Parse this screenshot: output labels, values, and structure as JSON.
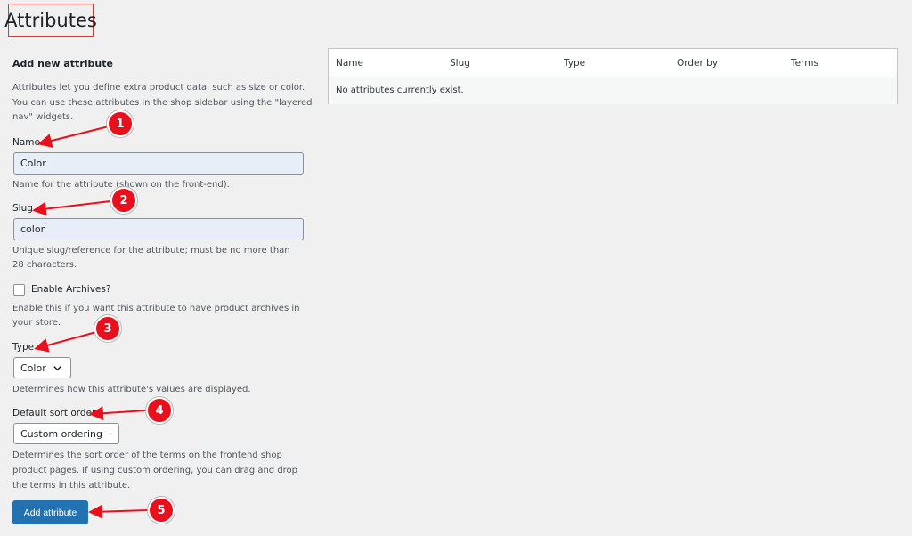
{
  "page": {
    "title": "Attributes"
  },
  "form": {
    "section_title": "Add new attribute",
    "intro_lines": [
      "Attributes let you define extra product data, such as size or color.",
      "You can use these attributes in the shop sidebar using the \"layered",
      "nav\" widgets."
    ],
    "name": {
      "label": "Name",
      "value": "Color",
      "help": "Name for the attribute (shown on the front-end)."
    },
    "slug": {
      "label": "Slug",
      "value": "color",
      "help_lines": [
        "Unique slug/reference for the attribute; must be no more than",
        "28 characters."
      ]
    },
    "archives": {
      "label": "Enable Archives?",
      "checked": false,
      "help_lines": [
        "Enable this if you want this attribute to have product archives in",
        "your store."
      ]
    },
    "type": {
      "label": "Type",
      "selected": "Color",
      "help": "Determines how this attribute's values are displayed."
    },
    "sort_order": {
      "label": "Default sort order",
      "selected": "Custom ordering",
      "help_lines": [
        "Determines the sort order of the terms on the frontend shop",
        "product pages. If using custom ordering, you can drag and drop",
        "the terms in this attribute."
      ]
    },
    "submit_label": "Add attribute"
  },
  "table": {
    "columns": [
      "Name",
      "Slug",
      "Type",
      "Order by",
      "Terms"
    ],
    "empty_message": "No attributes currently exist."
  },
  "annotations": [
    "1",
    "2",
    "3",
    "4",
    "5"
  ],
  "colors": {
    "accent": "#2271b1",
    "annotation": "#e8101d",
    "highlight_border": "#d63638",
    "background": "#f0f0f1"
  }
}
